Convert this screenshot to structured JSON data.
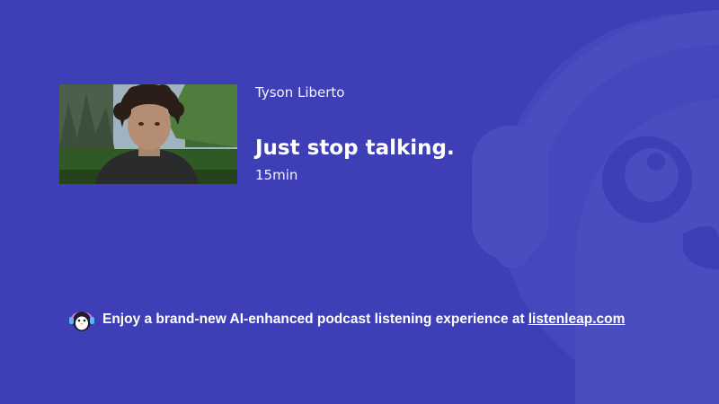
{
  "episode": {
    "author": "Tyson Liberto",
    "title": "Just stop talking.",
    "duration": "15min"
  },
  "promo": {
    "text": "Enjoy a brand-new AI-enhanced podcast listening experience at",
    "link_text": "listenleap.com"
  },
  "colors": {
    "background": "#3e3fb6",
    "mascot_overlay": "#4a4cc0",
    "text": "#ffffff"
  },
  "icons": {
    "promo": "penguin-headphones-icon",
    "background": "mascot-headphones-icon"
  }
}
